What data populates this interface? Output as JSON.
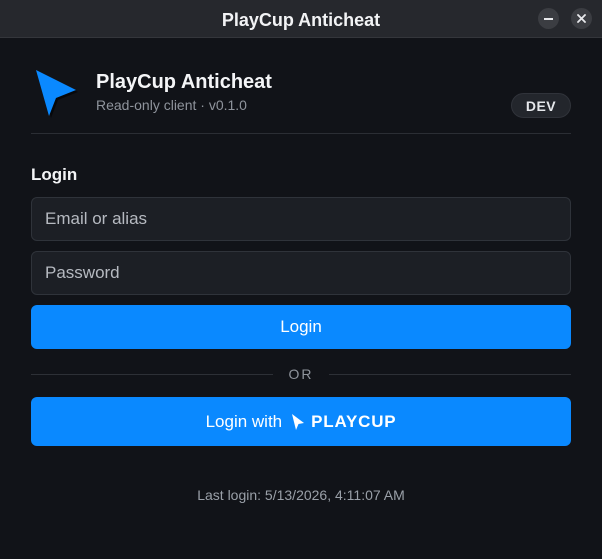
{
  "window": {
    "title": "PlayCup Anticheat",
    "minimize_glyph": "—",
    "close_glyph": "✕"
  },
  "header": {
    "app_name": "PlayCup Anticheat",
    "subtitle": "Read-only client · v0.1.0",
    "badge": "DEV",
    "logo_icon": "arrow-pointer-icon"
  },
  "login": {
    "section_title": "Login",
    "email_placeholder": "Email or alias",
    "email_value": "",
    "password_placeholder": "Password",
    "password_value": "",
    "login_button": "Login",
    "divider_text": "OR",
    "playcup_prefix": "Login with",
    "playcup_brand": "PLAYCUP"
  },
  "footer": {
    "last_login": "Last login: 5/13/2026, 4:11:07 AM"
  },
  "colors": {
    "accent": "#0a89ff",
    "background": "#111318",
    "titlebar": "#26282d",
    "input_bg": "#1c1f25"
  }
}
